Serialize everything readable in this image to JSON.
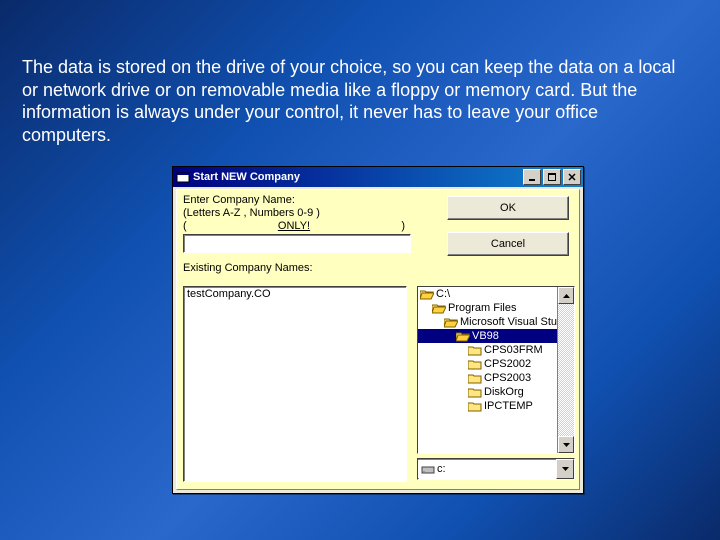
{
  "body_text": "The data is stored on the drive of your choice, so you can keep the data on a local or network drive or on removable media like a floppy or memory card.  But the information is always under your control, it never has to leave your office computers.",
  "dialog": {
    "title": "Start NEW Company",
    "prompt_line1": "Enter Company Name:",
    "prompt_line2": "(Letters A-Z , Numbers 0-9 )",
    "prompt_line3_left": "(",
    "prompt_line3_mid": "ONLY!",
    "prompt_line3_right": ")",
    "company_value": "",
    "existing_label": "Existing Company Names:",
    "ok_label": "OK",
    "cancel_label": "Cancel",
    "list_items": [
      "testCompany.CO"
    ],
    "tree": [
      {
        "label": "C:\\",
        "level": 0
      },
      {
        "label": "Program Files",
        "level": 1
      },
      {
        "label": "Microsoft Visual Stu",
        "level": 2
      },
      {
        "label": "VB98",
        "level": 3,
        "selected": true
      },
      {
        "label": "CPS03FRM",
        "level": 4
      },
      {
        "label": "CPS2002",
        "level": 4
      },
      {
        "label": "CPS2003",
        "level": 4
      },
      {
        "label": "DiskOrg",
        "level": 4
      },
      {
        "label": "IPCTEMP",
        "level": 4
      }
    ],
    "drive_label": "c:"
  }
}
